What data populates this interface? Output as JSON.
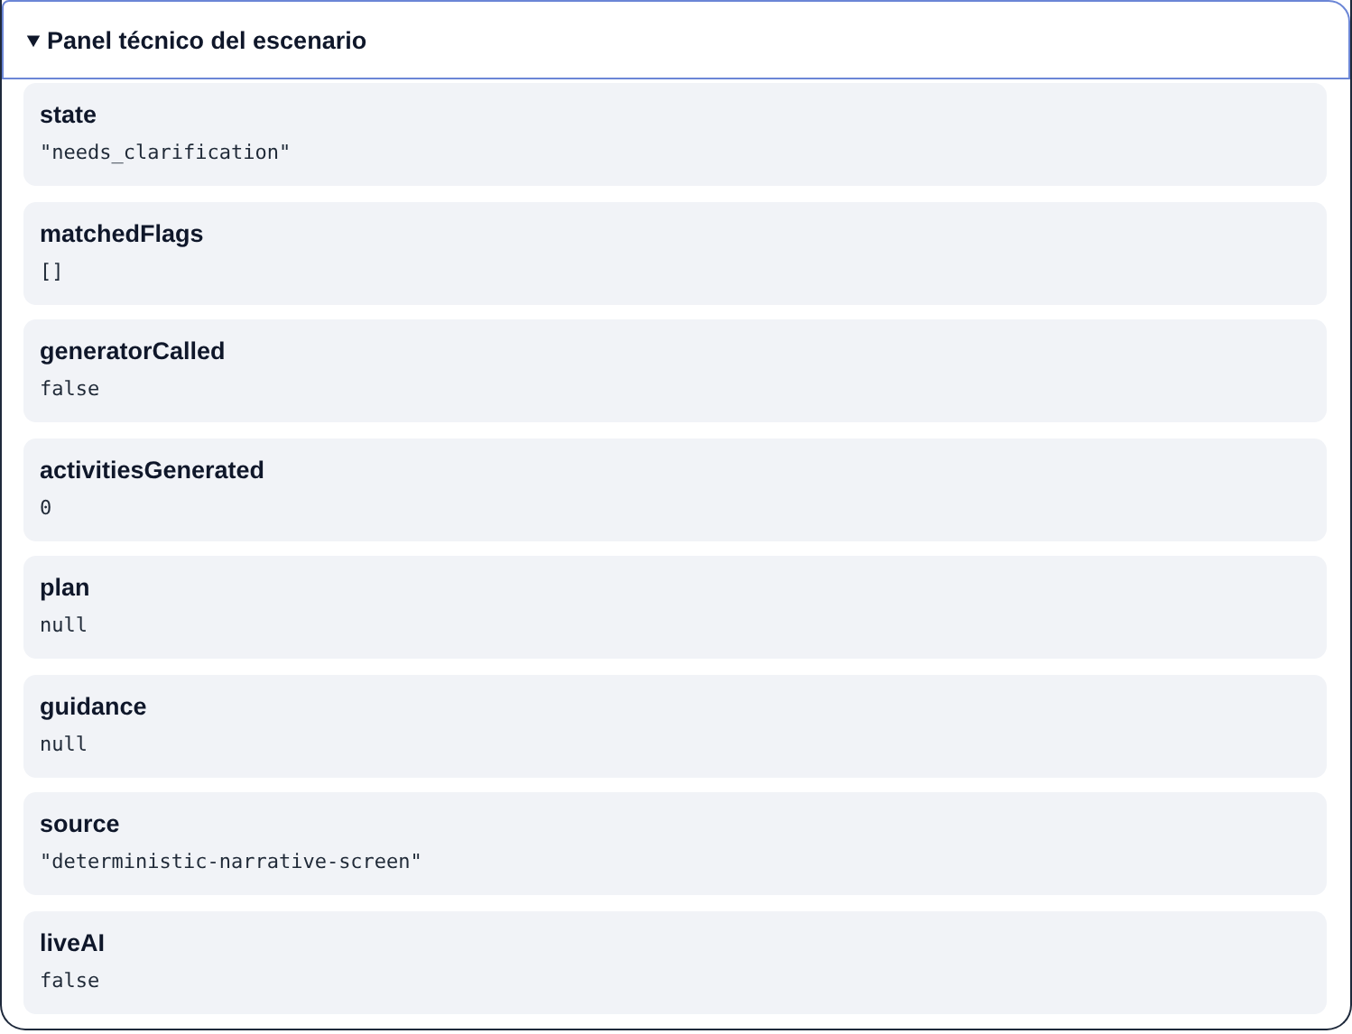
{
  "panel": {
    "title": "Panel técnico del escenario",
    "expanded": true,
    "fields": [
      {
        "key": "state",
        "value": "\"needs_clarification\""
      },
      {
        "key": "matchedFlags",
        "value": "[]"
      },
      {
        "key": "generatorCalled",
        "value": "false"
      },
      {
        "key": "activitiesGenerated",
        "value": "0"
      },
      {
        "key": "plan",
        "value": "null"
      },
      {
        "key": "guidance",
        "value": "null"
      },
      {
        "key": "source",
        "value": "\"deterministic-narrative-screen\""
      },
      {
        "key": "liveAI",
        "value": "false"
      }
    ]
  }
}
